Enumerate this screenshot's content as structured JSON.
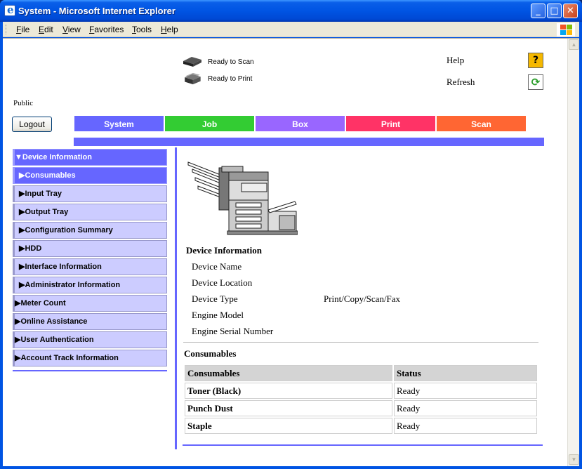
{
  "window": {
    "title": "System - Microsoft Internet Explorer",
    "controls": {
      "minimize": "_",
      "maximize": "□",
      "close": "✕"
    }
  },
  "menubar": {
    "items": [
      "File",
      "Edit",
      "View",
      "Favorites",
      "Tools",
      "Help"
    ]
  },
  "status": {
    "scan": "Ready to Scan",
    "print": "Ready to Print"
  },
  "utility": {
    "help": "Help",
    "refresh": "Refresh",
    "help_glyph": "?",
    "refresh_glyph": "⟳"
  },
  "user": {
    "mode": "Public",
    "logout": "Logout"
  },
  "nav": {
    "tabs": [
      {
        "label": "System",
        "color": "#6666ff"
      },
      {
        "label": "Job",
        "color": "#33cc33"
      },
      {
        "label": "Box",
        "color": "#9966ff"
      },
      {
        "label": "Print",
        "color": "#ff3366"
      },
      {
        "label": "Scan",
        "color": "#ff6633"
      }
    ]
  },
  "leftmenu": {
    "items": [
      {
        "label": "▼Device Information",
        "active": true
      },
      {
        "label": "▶Consumables",
        "active": true
      },
      {
        "label": "▶Input Tray"
      },
      {
        "label": "▶Output Tray"
      },
      {
        "label": "▶Configuration Summary"
      },
      {
        "label": "▶HDD"
      },
      {
        "label": "▶Interface Information"
      },
      {
        "label": "▶Administrator Information"
      },
      {
        "label": "▶Meter Count"
      },
      {
        "label": "▶Online Assistance"
      },
      {
        "label": "▶User Authentication"
      },
      {
        "label": "▶Account Track Information"
      }
    ]
  },
  "device": {
    "heading": "Device Information",
    "rows": [
      {
        "label": "Device Name",
        "value": ""
      },
      {
        "label": "Device Location",
        "value": ""
      },
      {
        "label": "Device Type",
        "value": "Print/Copy/Scan/Fax"
      },
      {
        "label": "Engine Model",
        "value": ""
      },
      {
        "label": "Engine Serial Number",
        "value": ""
      }
    ]
  },
  "consumables": {
    "heading": "Consumables",
    "columns": [
      "Consumables",
      "Status"
    ],
    "rows": [
      {
        "name": "Toner (Black)",
        "status": "Ready"
      },
      {
        "name": "Punch Dust",
        "status": "Ready"
      },
      {
        "name": "Staple",
        "status": "Ready"
      }
    ]
  }
}
